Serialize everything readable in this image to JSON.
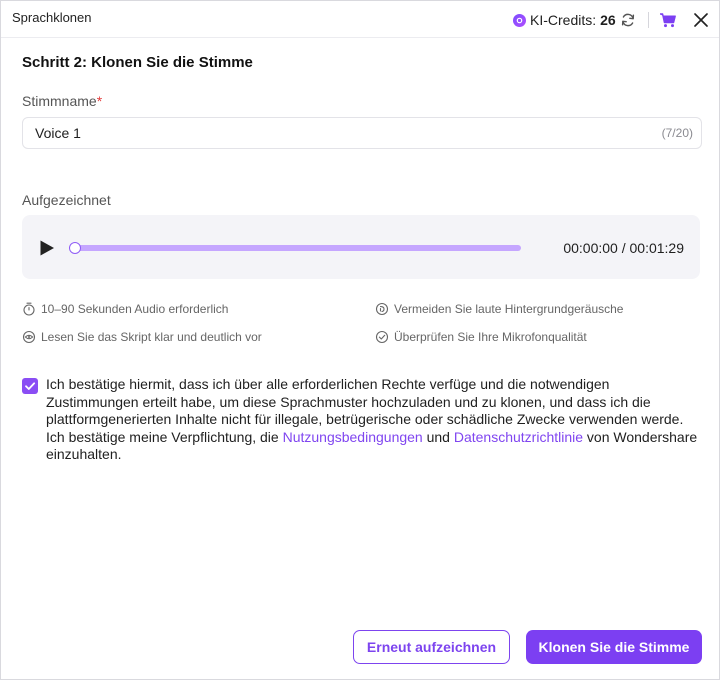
{
  "window": {
    "title": "Sprachklonen"
  },
  "header": {
    "credits_label": "KI-Credits:",
    "credits_value": "26",
    "icons": [
      "credit-coin-icon",
      "refresh-icon",
      "cart-icon",
      "close-icon"
    ]
  },
  "step": {
    "title": "Schritt 2: Klonen Sie die Stimme"
  },
  "name_field": {
    "label": "Stimmname",
    "required_mark": "*",
    "value": "Voice 1",
    "counter": "(7/20)"
  },
  "recording": {
    "label": "Aufgezeichnet",
    "time": "00:00:00 / 00:01:29",
    "progress": 0
  },
  "tips": [
    {
      "icon": "timer-icon",
      "text": "10–90 Sekunden Audio erforderlich"
    },
    {
      "icon": "noise-icon",
      "text": "Vermeiden Sie laute Hintergrundgeräusche"
    },
    {
      "icon": "eye-icon",
      "text": "Lesen Sie das Skript klar und deutlich vor"
    },
    {
      "icon": "check-circle-icon",
      "text": "Überprüfen Sie Ihre Mikrofonqualität"
    }
  ],
  "consent": {
    "checked": true,
    "text_before": "Ich bestätige hiermit, dass ich über alle erforderlichen Rechte verfüge und die notwendigen Zustimmungen erteilt habe, um diese Sprachmuster hochzuladen und zu klonen, und dass ich die plattformgenerierten Inhalte nicht für illegale, betrügerische oder schädliche Zwecke verwenden werde. Ich bestätige meine Verpflichtung, die ",
    "link_terms": "Nutzungsbedingungen",
    "text_and": " und ",
    "link_privacy": "Datenschutzrichtlinie",
    "text_after": " von Wondershare einzuhalten."
  },
  "buttons": {
    "rerecord": "Erneut aufzeichnen",
    "clone": "Klonen Sie die Stimme"
  },
  "colors": {
    "accent": "#7c3ff2",
    "track": "#c5a6ff",
    "panel": "#f4f4f8",
    "required": "#e23b3b"
  }
}
